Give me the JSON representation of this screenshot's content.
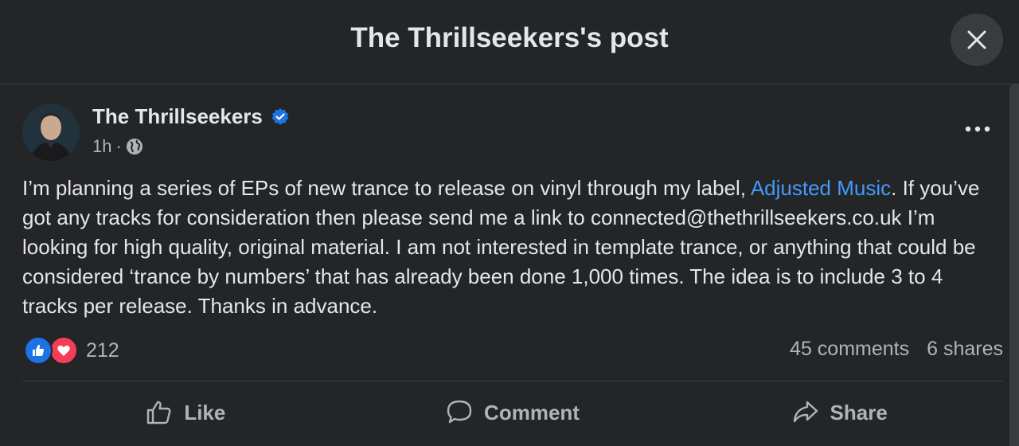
{
  "dialog": {
    "title": "The Thrillseekers's post",
    "close_icon": "close-icon"
  },
  "post": {
    "author": "The Thrillseekers",
    "verified": true,
    "time": "1h",
    "separator": "·",
    "audience_icon": "globe-icon",
    "text_before_link": "I’m planning a series of EPs of new trance to release on vinyl through my label, ",
    "link_text": "Adjusted Music",
    "text_after_link": ". If you’ve got any tracks for consideration then please send me a link to connected@thethrillseekers.co.uk I’m looking for high quality, original material. I am not interested in template trance, or anything that could be considered ‘trance by numbers’ that has already been done 1,000 times. The idea is to include 3 to 4 tracks per release. Thanks in advance."
  },
  "engagement": {
    "reaction_icons": [
      "like-reaction-icon",
      "love-reaction-icon"
    ],
    "reaction_count": "212",
    "comments": "45 comments",
    "shares": "6 shares"
  },
  "actions": {
    "like": "Like",
    "comment": "Comment",
    "share": "Share"
  },
  "colors": {
    "background": "#242526",
    "link": "#4599ff",
    "like_blue": "#1b74e4",
    "love_red": "#f33e58",
    "secondary_text": "#b0b3b8"
  }
}
